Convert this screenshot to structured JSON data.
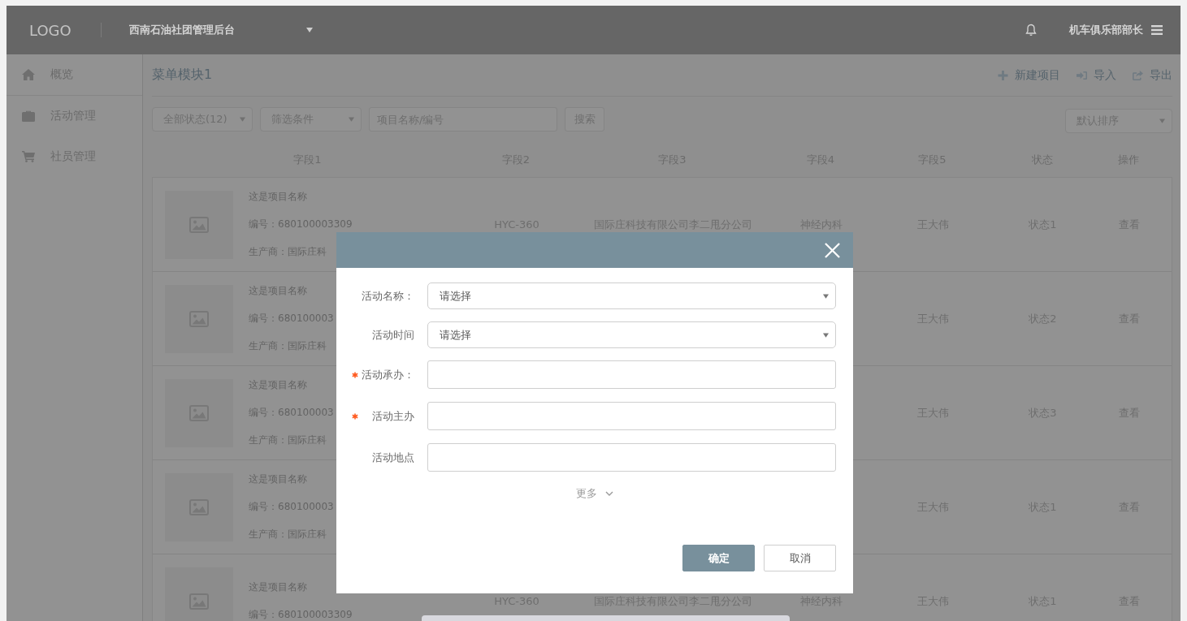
{
  "header": {
    "logo": "LOGO",
    "title": "西南石油社团管理后台",
    "user": "机车俱乐部部长"
  },
  "sidebar": {
    "items": [
      {
        "kind": "home",
        "label": "概览"
      },
      {
        "kind": "briefcase",
        "label": "活动管理"
      },
      {
        "kind": "cart",
        "label": "社员管理"
      }
    ]
  },
  "toolbar": {
    "title": "菜单模块1",
    "actions": [
      {
        "kind": "plus",
        "label": "新建项目"
      },
      {
        "kind": "import",
        "label": "导入"
      },
      {
        "kind": "export",
        "label": "导出"
      }
    ],
    "status_select": "全部状态(12)",
    "condition_select": "筛选条件",
    "search": {
      "placeholder": "项目名称/编号"
    },
    "search_button": "搜索",
    "sort_select": "默认排序"
  },
  "table": {
    "columns": [
      "字段1",
      "字段2",
      "字段3",
      "字段4",
      "字段5",
      "状态",
      "操作"
    ],
    "rows": [
      {
        "name": "这是项目名称",
        "code": "编号：680100003309",
        "maker": "生产商：国际庄科",
        "field_2": "HYC-360",
        "field_3": "国际庄科技有限公司李二甩分公司",
        "field_4": "神经内科",
        "field_5": "王大伟",
        "status": "状态1",
        "action": "查看"
      },
      {
        "name": "这是项目名称",
        "code": "编号：680100003",
        "maker": "生产商：国际庄科",
        "field_5": "王大伟",
        "status": "状态2",
        "action": "查看"
      },
      {
        "name": "这是项目名称",
        "code": "编号：680100003",
        "maker": "生产商：国际庄科",
        "field_5": "王大伟",
        "status": "状态3",
        "action": "查看"
      },
      {
        "name": "这是项目名称",
        "code": "编号：680100003",
        "maker": "生产商：国际庄科",
        "field_5": "王大伟",
        "status": "状态1",
        "action": "查看"
      },
      {
        "name": "这是项目名称",
        "code": "编号：680100003309",
        "field_2": "HYC-360",
        "field_3": "国际庄科技有限公司李二甩分公司",
        "field_4": "神经内科",
        "field_5": "王大伟",
        "status": "状态1",
        "action": "查看"
      }
    ]
  },
  "dialog": {
    "fields": [
      {
        "kind": "select",
        "label": "活动名称：",
        "required": false,
        "placeholder": "请选择"
      },
      {
        "kind": "select",
        "label": "活动时间",
        "required": false,
        "placeholder": "请选择"
      },
      {
        "kind": "input",
        "label": "活动承办：",
        "required": true
      },
      {
        "kind": "input",
        "label": "活动主办",
        "required": true
      },
      {
        "kind": "input",
        "label": "活动地点",
        "required": false
      }
    ],
    "more": "更多",
    "buttons": [
      {
        "kind": "primary",
        "label": "确定"
      },
      {
        "kind": "default",
        "label": "取消"
      }
    ]
  }
}
